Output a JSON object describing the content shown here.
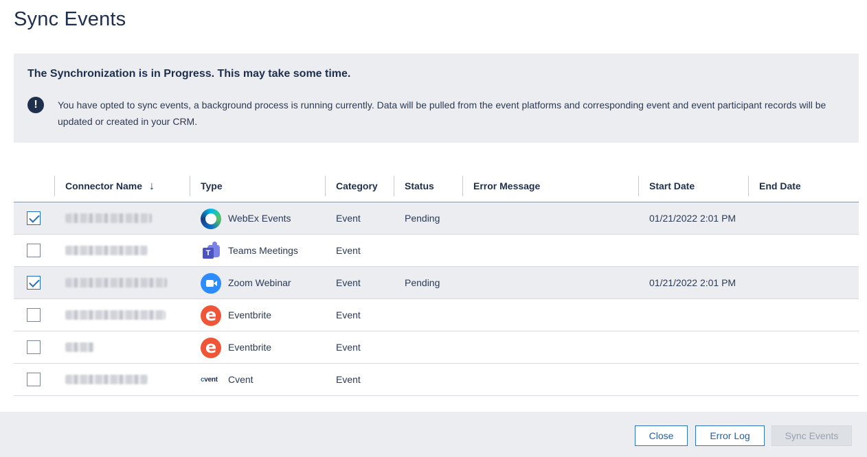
{
  "page": {
    "title": "Sync Events"
  },
  "banner": {
    "title": "The Synchronization is in Progress. This may take some time.",
    "icon": "exclamation-circle-icon",
    "message": "You have opted to sync events, a background process is running currently. Data will be pulled from the event platforms and corresponding event and event participant records will be updated or created in your CRM."
  },
  "table": {
    "columns": {
      "connector_name": "Connector Name",
      "type": "Type",
      "category": "Category",
      "status": "Status",
      "error_message": "Error Message",
      "start_date": "Start Date",
      "end_date": "End Date"
    },
    "sort_icon": "arrow-down-icon",
    "rows": [
      {
        "selected": true,
        "type": "WebEx Events",
        "type_icon": "webex-icon",
        "category": "Event",
        "status": "Pending",
        "error_message": "",
        "start_date": "01/21/2022 2:01 PM",
        "end_date": ""
      },
      {
        "selected": false,
        "type": "Teams Meetings",
        "type_icon": "teams-icon",
        "category": "Event",
        "status": "",
        "error_message": "",
        "start_date": "",
        "end_date": ""
      },
      {
        "selected": true,
        "type": "Zoom Webinar",
        "type_icon": "zoom-icon",
        "category": "Event",
        "status": "Pending",
        "error_message": "",
        "start_date": "01/21/2022 2:01 PM",
        "end_date": ""
      },
      {
        "selected": false,
        "type": "Eventbrite",
        "type_icon": "eventbrite-icon",
        "category": "Event",
        "status": "",
        "error_message": "",
        "start_date": "",
        "end_date": ""
      },
      {
        "selected": false,
        "type": "Eventbrite",
        "type_icon": "eventbrite-icon",
        "category": "Event",
        "status": "",
        "error_message": "",
        "start_date": "",
        "end_date": ""
      },
      {
        "selected": false,
        "type": "Cvent",
        "type_icon": "cvent-icon",
        "category": "Event",
        "status": "",
        "error_message": "",
        "start_date": "",
        "end_date": ""
      }
    ]
  },
  "footer": {
    "close_label": "Close",
    "error_log_label": "Error Log",
    "sync_events_label": "Sync Events"
  },
  "colors": {
    "primary_text": "#1e2f4d",
    "accent_blue": "#1f6fc4",
    "panel_gray": "#ebedf0"
  }
}
